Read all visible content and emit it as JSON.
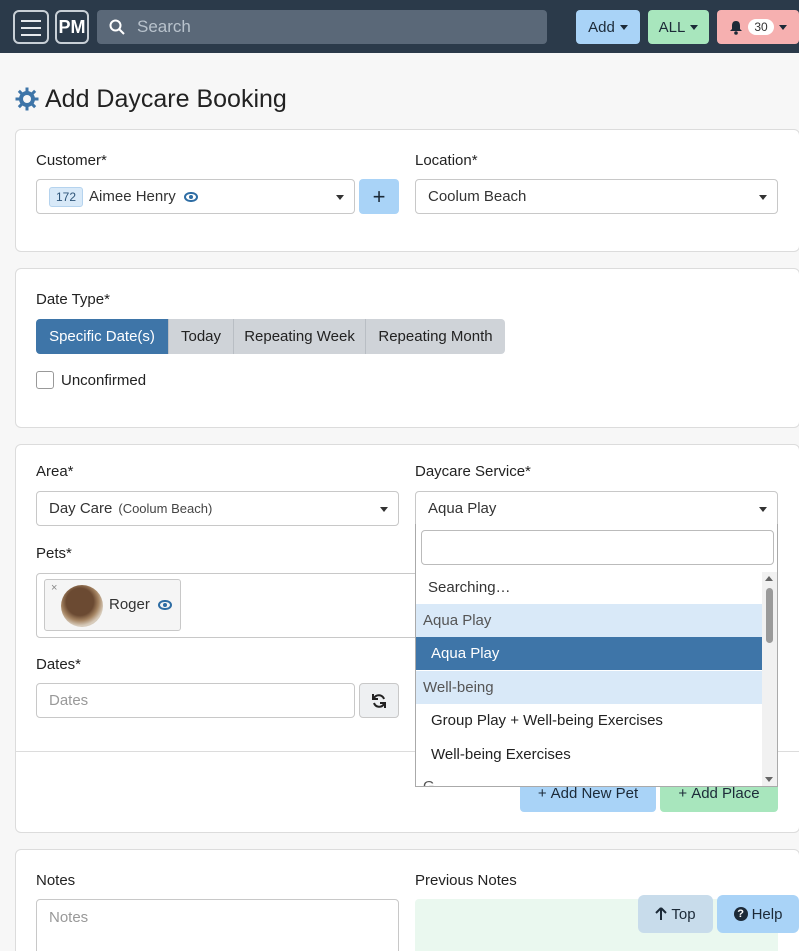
{
  "navbar": {
    "logo": "PM",
    "search_placeholder": "Search",
    "add_label": "Add",
    "all_label": "ALL",
    "notifications_count": "30"
  },
  "page": {
    "title": "Add Daycare Booking"
  },
  "customer_card": {
    "customer_label": "Customer*",
    "customer_id": "172",
    "customer_name": "Aimee Henry",
    "add_button": "+",
    "location_label": "Location*",
    "location_value": "Coolum Beach"
  },
  "date_card": {
    "date_type_label": "Date Type*",
    "date_types": [
      "Specific Date(s)",
      "Today",
      "Repeating Week",
      "Repeating Month"
    ],
    "active_date_type": "Specific Date(s)",
    "unconfirmed_label": "Unconfirmed"
  },
  "service_card": {
    "area_label": "Area*",
    "area_value": "Day Care",
    "area_sub": "(Coolum Beach)",
    "service_label": "Daycare Service*",
    "service_value": "Aqua Play",
    "pets_label": "Pets*",
    "pet_remove": "×",
    "pet_name": "Roger",
    "dates_label": "Dates*",
    "dates_placeholder": "Dates",
    "add_new_pet": "Add New Pet",
    "add_place": "Add Place"
  },
  "dropdown": {
    "searching": "Searching…",
    "groups": [
      {
        "label": "Aqua Play",
        "options": [
          "Aqua Play"
        ]
      },
      {
        "label": "Well-being",
        "options": [
          "Group Play + Well-being Exercises",
          "Well-being Exercises"
        ]
      }
    ],
    "selected": "Aqua Play",
    "partial_next": "G"
  },
  "notes_card": {
    "notes_label": "Notes",
    "notes_placeholder": "Notes",
    "previous_notes_label": "Previous Notes"
  },
  "floating": {
    "top_label": "Top",
    "help_label": "Help"
  }
}
